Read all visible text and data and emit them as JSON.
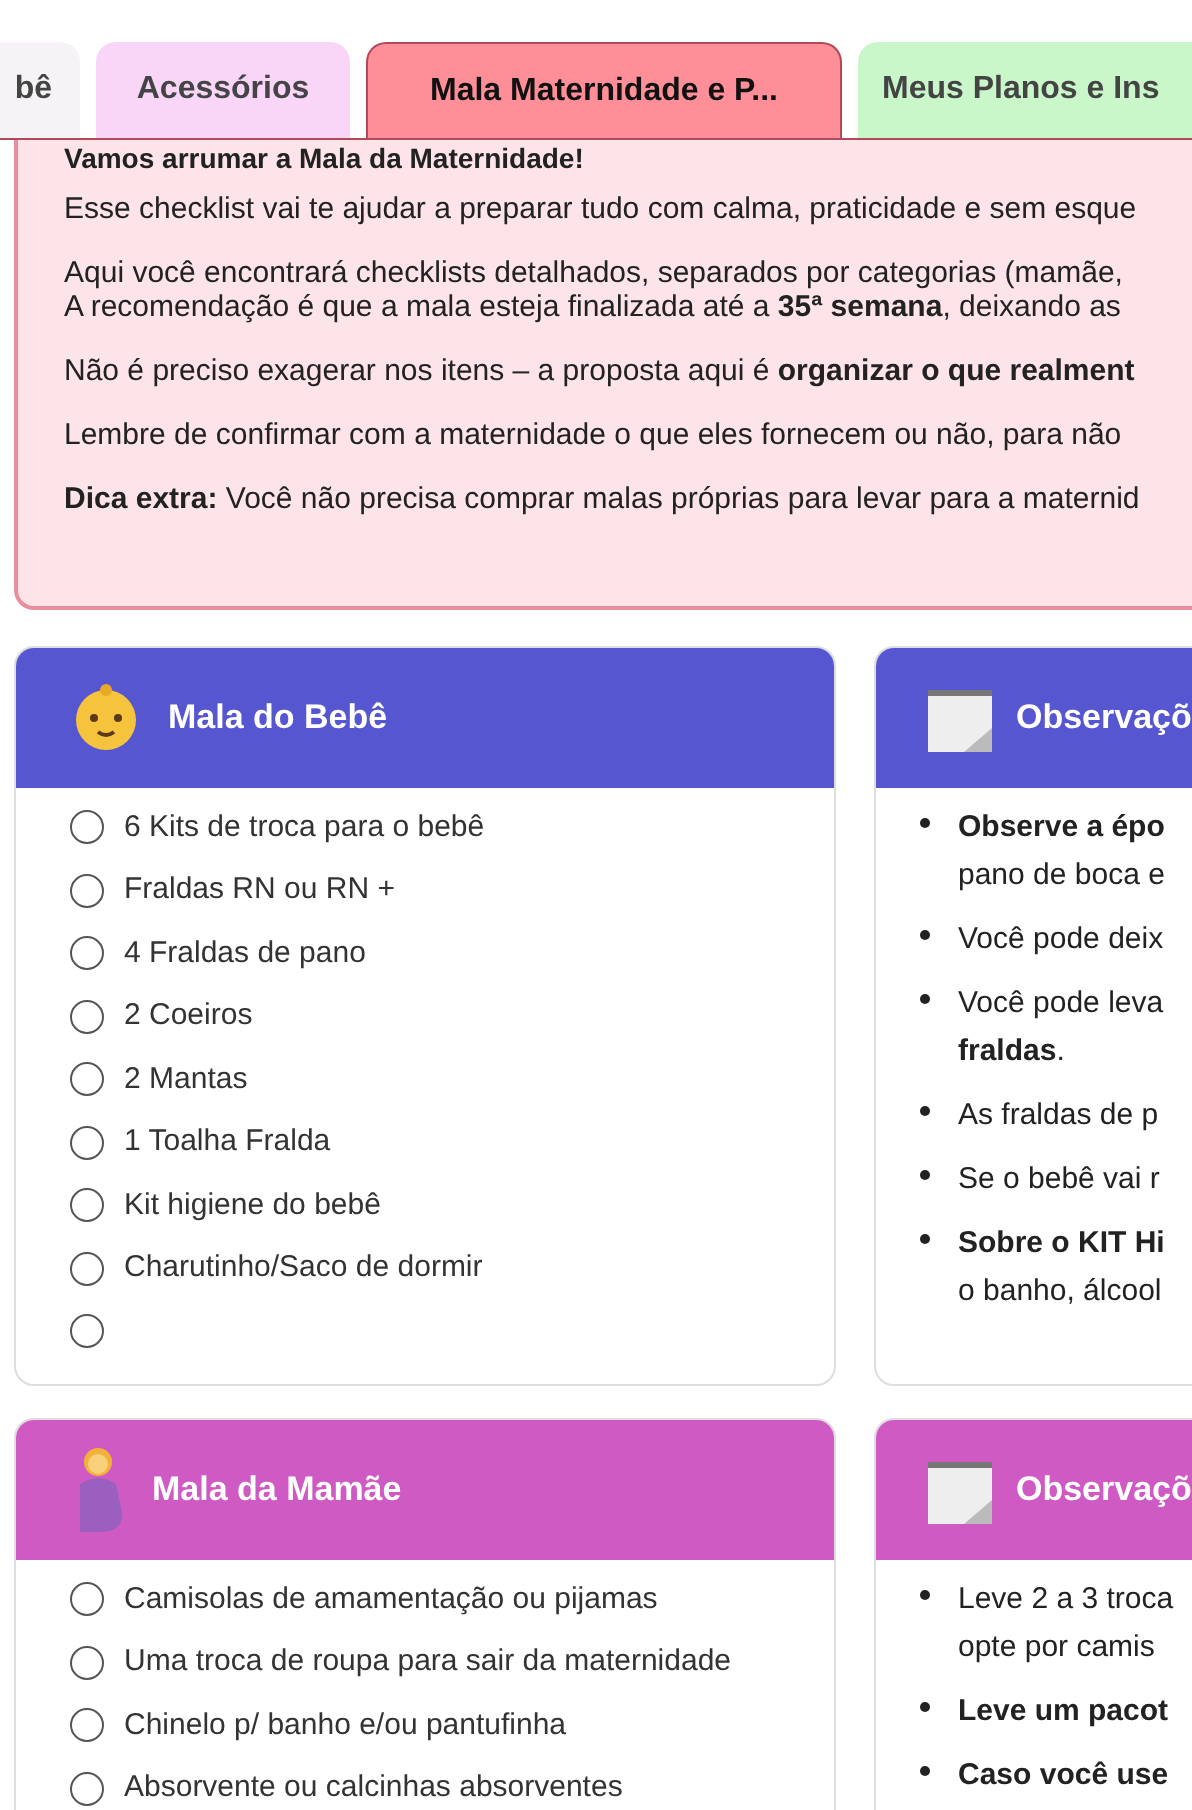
{
  "tabs": [
    {
      "label": "bê",
      "selected": false,
      "color": "#f6f3f6"
    },
    {
      "label": "Acessórios",
      "selected": false,
      "color": "#f9d5f7"
    },
    {
      "label": "Mala Maternidade e P...",
      "selected": true,
      "color": "#fe8f98"
    },
    {
      "label": "Meus Planos e Ins",
      "selected": false,
      "color": "#c9f7c9"
    }
  ],
  "intro": {
    "title": "Vamos arrumar a Mala da Maternidade!",
    "paragraphs": [
      {
        "lines": [
          "Esse checklist vai te ajudar a preparar tudo com calma, praticidade e sem esque"
        ]
      },
      {
        "lines": [
          "Aqui você encontrará checklists detalhados, separados por categorias (mamãe,",
          "A recomendação é que a mala esteja finalizada até a **35ª semana**, deixando as"
        ]
      },
      {
        "lines": [
          "Não é preciso exagerar nos itens – a proposta aqui é **organizar o que realment**"
        ]
      },
      {
        "lines": [
          "Lembre de confirmar com a maternidade o que eles fornecem ou não, para não"
        ]
      },
      {
        "lines": [
          "**Dica extra:** Você não precisa comprar malas próprias para levar para a maternid"
        ]
      }
    ]
  },
  "sections": [
    {
      "kind": "baby",
      "title": "Mala do Bebê",
      "color": "#5656d0",
      "items": [
        {
          "label": "6 Kits de troca para o bebê",
          "checked": false
        },
        {
          "label": "Fraldas RN ou RN +",
          "checked": false
        },
        {
          "label": "4 Fraldas de pano",
          "checked": false
        },
        {
          "label": "2 Coeiros",
          "checked": false
        },
        {
          "label": "2 Mantas",
          "checked": false
        },
        {
          "label": "1 Toalha Fralda",
          "checked": false
        },
        {
          "label": "Kit higiene do bebê",
          "checked": false
        },
        {
          "label": "Charutinho/Saco de dormir",
          "checked": false
        },
        {
          "checked": false
        }
      ],
      "notes_title": "Observaçõ",
      "notes": [
        {
          "lines": [
            "**Observe a épo**",
            "pano de boca e"
          ]
        },
        {
          "lines": [
            "Você pode deix"
          ]
        },
        {
          "lines": [
            "Você pode leva",
            "**fraldas**."
          ]
        },
        {
          "lines": [
            "As fraldas de p"
          ]
        },
        {
          "lines": [
            "Se o bebê vai r"
          ]
        },
        {
          "lines": [
            "**Sobre o KIT Hi**",
            "o banho, álcool"
          ]
        }
      ]
    },
    {
      "kind": "mother",
      "title": "Mala da Mamãe",
      "color": "#d05ac4",
      "items": [
        {
          "label": "Camisolas de amamentação ou pijamas",
          "checked": false
        },
        {
          "label": "Uma troca de roupa para sair da maternidade",
          "checked": false
        },
        {
          "label": "Chinelo p/ banho e/ou pantufinha",
          "checked": false
        },
        {
          "label": "Absorvente ou calcinhas absorventes",
          "checked": false
        }
      ],
      "notes_title": "Observaçõ",
      "notes": [
        {
          "lines": [
            "Leve 2 a 3 troca",
            "opte por camis"
          ]
        },
        {
          "lines": [
            "**Leve um pacot**"
          ]
        },
        {
          "lines": [
            "**Caso você use**"
          ]
        }
      ]
    }
  ]
}
